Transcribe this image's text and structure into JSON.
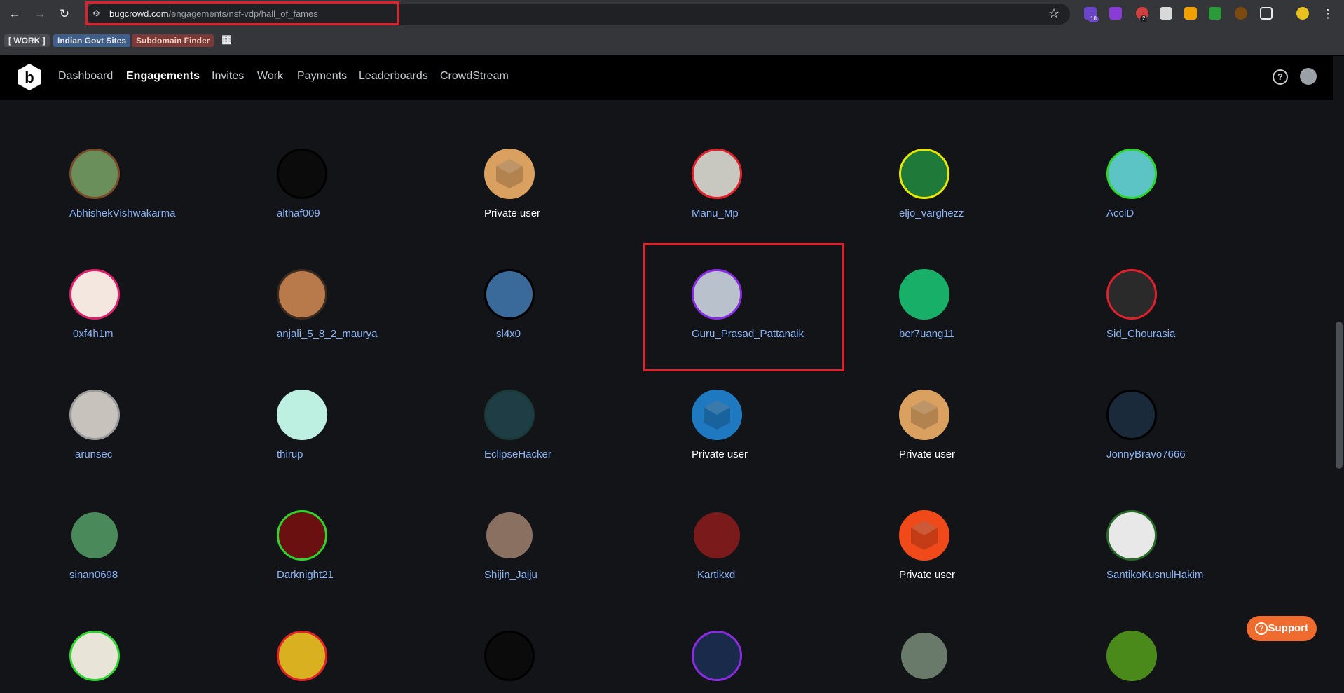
{
  "browser": {
    "url_host": "bugcrowd.com",
    "url_path": "/engagements/nsf-vdp/hall_of_fames",
    "extension_badges": [
      "18",
      "2"
    ],
    "bookmarks": [
      "[ WORK ]",
      "Indian Govt Sites",
      "Subdomain Finder"
    ]
  },
  "app": {
    "nav": [
      "Dashboard",
      "Engagements",
      "Invites",
      "Work",
      "Payments",
      "Leaderboards",
      "CrowdStream"
    ],
    "active_nav": "Engagements",
    "support_label": "Support"
  },
  "hall_of_fame": [
    [
      {
        "name": "AbhishekVishwakarma",
        "ring": "#7a4a2a",
        "fill": "#6b8f5a"
      },
      {
        "name": "althaf009",
        "ring": "#000000",
        "fill": "#0b0b0b"
      },
      {
        "name": "Private user",
        "ring": "#d9a060",
        "fill": "#d9a060",
        "private": true
      },
      {
        "name": "Manu_Mp",
        "ring": "#e0202a",
        "fill": "#c8c8c0"
      },
      {
        "name": "eljo_varghezz",
        "ring": "#e6e600",
        "fill": "#1f7a3a"
      },
      {
        "name": "AcciD",
        "ring": "#2fd42f",
        "fill": "#5cc4c4"
      }
    ],
    [
      {
        "name": "0xf4h1m",
        "ring": "#e0206e",
        "fill": "#f3e7e0"
      },
      {
        "name": "anjali_5_8_2_maurya",
        "ring": "#3a2a20",
        "fill": "#b87a4a"
      },
      {
        "name": "sl4x0",
        "ring": "#000000",
        "fill": "#3a6a9a"
      },
      {
        "name": "Guru_Prasad_Pattanaik",
        "ring": "#8a2be2",
        "fill": "#b9c2cc"
      },
      {
        "name": "ber7uang11",
        "ring": "#18b068",
        "fill": "#18b068"
      },
      {
        "name": "Sid_Chourasia",
        "ring": "#e0202a",
        "fill": "#2a2a2a"
      }
    ],
    [
      {
        "name": "arunsec",
        "ring": "#9a9a9a",
        "fill": "#c8c2bc"
      },
      {
        "name": "thirup",
        "ring": "#bdf0e0",
        "fill": "#bdf0e0"
      },
      {
        "name": "EclipseHacker",
        "ring": "#1a3a3a",
        "fill": "#1f3d44"
      },
      {
        "name": "Private user",
        "ring": "#1e79c0",
        "fill": "#1e79c0",
        "private": true
      },
      {
        "name": "Private user",
        "ring": "#d9a060",
        "fill": "#d9a060",
        "private": true
      },
      {
        "name": "JonnyBravo7666",
        "ring": "#000000",
        "fill": "#1a2a3a"
      }
    ],
    [
      {
        "name": "sinan0698",
        "ring": "#121418",
        "fill": "#4a8a5a"
      },
      {
        "name": "Darknight21",
        "ring": "#2fd42f",
        "fill": "#6a1010"
      },
      {
        "name": "Shijin_Jaiju",
        "ring": "#121418",
        "fill": "#8a7060"
      },
      {
        "name": "Kartikxd",
        "ring": "#121418",
        "fill": "#7a1a1a"
      },
      {
        "name": "Private user",
        "ring": "#f04a1a",
        "fill": "#f04a1a",
        "private": true
      },
      {
        "name": "SantikoKusnulHakim",
        "ring": "#2a6a2a",
        "fill": "#e8e8e8"
      }
    ],
    [
      {
        "name": "",
        "ring": "#2fd42f",
        "fill": "#e8e4d8"
      },
      {
        "name": "",
        "ring": "#e0202a",
        "fill": "#d8b020"
      },
      {
        "name": "",
        "ring": "#000000",
        "fill": "#0b0b0b"
      },
      {
        "name": "",
        "ring": "#8a2be2",
        "fill": "#1a2a4a"
      },
      {
        "name": "",
        "ring": "#121418",
        "fill": "#6a7a6a"
      },
      {
        "name": "",
        "ring": "#4a8a1a",
        "fill": "#4a8a1a"
      }
    ]
  ]
}
